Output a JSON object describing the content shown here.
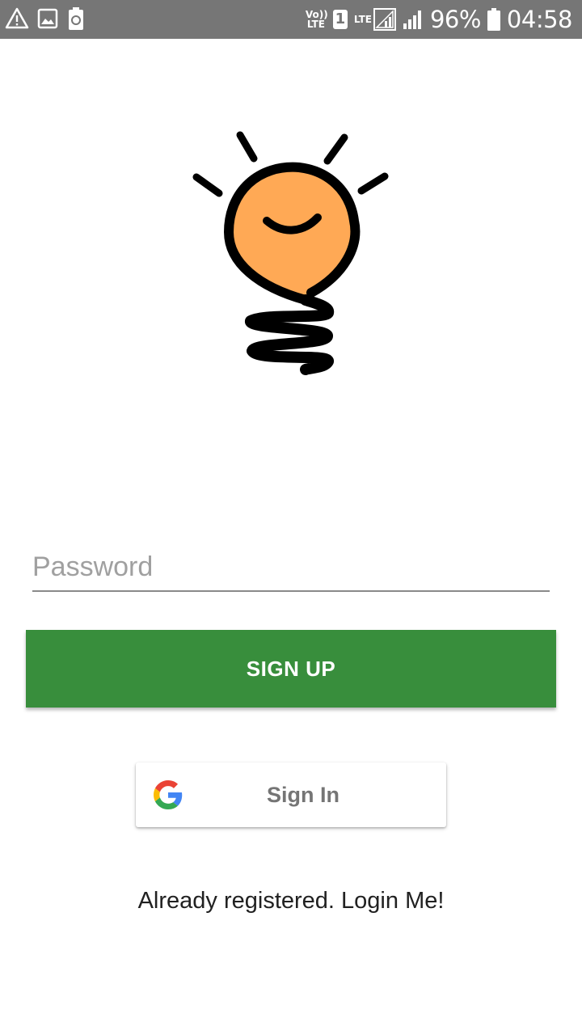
{
  "status_bar": {
    "left_icons": [
      "warning-icon",
      "image-icon",
      "battery-saver-icon"
    ],
    "volte": "Vo))\nLTE",
    "sim_slot": "1",
    "lte_label": "LTE",
    "battery_percent": "96%",
    "time": "04:58"
  },
  "logo": {
    "icon": "lightbulb-icon",
    "fill_color": "#FFA955"
  },
  "form": {
    "password_placeholder": "Password",
    "signup_label": "SIGN UP",
    "signup_color": "#388E3C"
  },
  "google": {
    "label": "Sign In"
  },
  "login_link": "Already registered. Login Me!"
}
